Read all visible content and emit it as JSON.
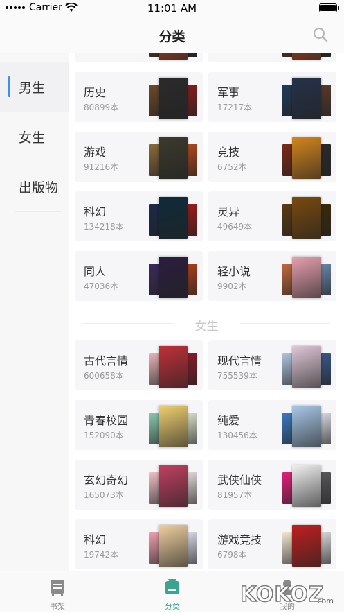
{
  "status_bar": {
    "carrier": "Carrier",
    "time": "11:01 AM"
  },
  "nav": {
    "title": "分类"
  },
  "sidebar": {
    "items": [
      {
        "label": "男生",
        "active": true
      },
      {
        "label": "女生",
        "active": false
      },
      {
        "label": "出版物",
        "active": false
      }
    ]
  },
  "content": {
    "male_categories": [
      {
        "name": "历史",
        "count": "80899本",
        "colors": [
          "#6b4a2a",
          "#2b2b2b",
          "#8a1c1c"
        ]
      },
      {
        "name": "军事",
        "count": "17217本",
        "colors": [
          "#1f3a5a",
          "#25324a",
          "#5a3a2a"
        ]
      },
      {
        "name": "游戏",
        "count": "91216本",
        "colors": [
          "#8a6a3a",
          "#3a3a2e",
          "#b24a1a"
        ]
      },
      {
        "name": "竞技",
        "count": "6752本",
        "colors": [
          "#7a2a1a",
          "#d4861c",
          "#2a2a2a"
        ]
      },
      {
        "name": "科幻",
        "count": "134218本",
        "colors": [
          "#1a2a4a",
          "#0e2c3a",
          "#a01a1a"
        ]
      },
      {
        "name": "灵异",
        "count": "49649本",
        "colors": [
          "#5a3a12",
          "#7a4a0e",
          "#3a2a0a"
        ]
      },
      {
        "name": "同人",
        "count": "47036本",
        "colors": [
          "#3a2a5a",
          "#2a1e3e",
          "#b0401a"
        ]
      },
      {
        "name": "轻小说",
        "count": "9902本",
        "colors": [
          "#c06a3a",
          "#e8a0b0",
          "#6a8ab0"
        ]
      }
    ],
    "female_section_title": "女生",
    "female_categories": [
      {
        "name": "古代言情",
        "count": "600658本",
        "colors": [
          "#e8b4b8",
          "#c0303a",
          "#8a1a2a"
        ]
      },
      {
        "name": "现代言情",
        "count": "755539本",
        "colors": [
          "#b0c4e0",
          "#e0c8d8",
          "#3a5a8a"
        ]
      },
      {
        "name": "青春校园",
        "count": "152090本",
        "colors": [
          "#8ac8b0",
          "#f0d070",
          "#e0e8d0"
        ]
      },
      {
        "name": "纯爱",
        "count": "130456本",
        "colors": [
          "#3a7ac0",
          "#a8c8e8",
          "#e0e0e8"
        ]
      },
      {
        "name": "玄幻奇幻",
        "count": "165073本",
        "colors": [
          "#f0c0c8",
          "#c04060",
          "#e8e0e0"
        ]
      },
      {
        "name": "武侠仙侠",
        "count": "81957本",
        "colors": [
          "#e0207a",
          "#f0f0f0",
          "#5a5a5a"
        ]
      },
      {
        "name": "科幻",
        "count": "19742本",
        "colors": [
          "#f0a0b0",
          "#f0d0a0",
          "#e0e0f0"
        ]
      },
      {
        "name": "游戏竞技",
        "count": "6798本",
        "colors": [
          "#f0e8d0",
          "#c02020",
          "#e0e0e0"
        ]
      }
    ],
    "top_partial_colors": [
      "#6a3a1a",
      "#c04a20",
      "#2a2a2a"
    ]
  },
  "tab_bar": {
    "items": [
      {
        "label": "书架",
        "icon": "bookshelf-icon",
        "active": false
      },
      {
        "label": "分类",
        "icon": "category-icon",
        "active": true
      },
      {
        "label": "我的",
        "icon": "profile-icon",
        "active": false
      }
    ]
  },
  "accent_color": "#3aa58e",
  "sidebar_indicator_color": "#3d8ee8",
  "watermark": "KOKOZ.com"
}
